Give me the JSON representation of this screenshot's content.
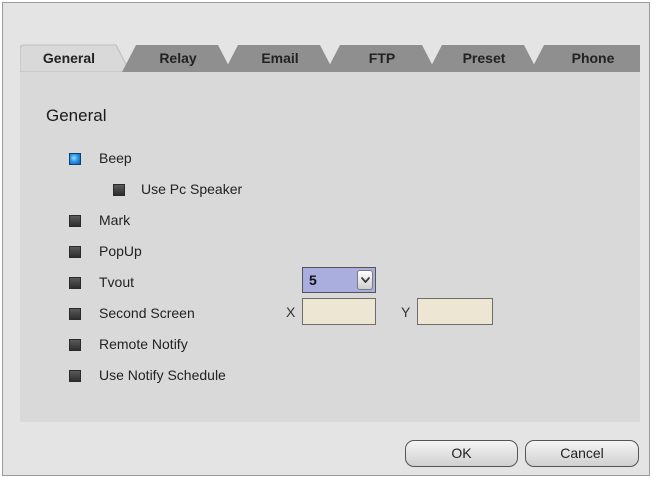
{
  "tabs": [
    {
      "label": "General",
      "active": true
    },
    {
      "label": "Relay",
      "active": false
    },
    {
      "label": "Email",
      "active": false
    },
    {
      "label": "FTP",
      "active": false
    },
    {
      "label": "Preset",
      "active": false
    },
    {
      "label": "Phone",
      "active": false
    }
  ],
  "section_title": "General",
  "options": {
    "beep": {
      "label": "Beep",
      "checked": true
    },
    "use_pc_speaker": {
      "label": "Use Pc Speaker",
      "checked": false
    },
    "mark": {
      "label": "Mark",
      "checked": false
    },
    "popup": {
      "label": "PopUp",
      "checked": false
    },
    "tvout": {
      "label": "Tvout",
      "checked": false
    },
    "second_screen": {
      "label": "Second Screen",
      "checked": false
    },
    "remote_notify": {
      "label": "Remote Notify",
      "checked": false
    },
    "use_notify_schedule": {
      "label": "Use Notify Schedule",
      "checked": false
    }
  },
  "tvout_select": {
    "value": "5"
  },
  "second_screen_coords": {
    "x_label": "X",
    "x_value": "",
    "y_label": "Y",
    "y_value": ""
  },
  "buttons": {
    "ok": "OK",
    "cancel": "Cancel"
  },
  "colors": {
    "checked": "#2d97e6",
    "panel": "#d9d9d9",
    "field": "#ede6d3",
    "select": "#a9aede"
  }
}
